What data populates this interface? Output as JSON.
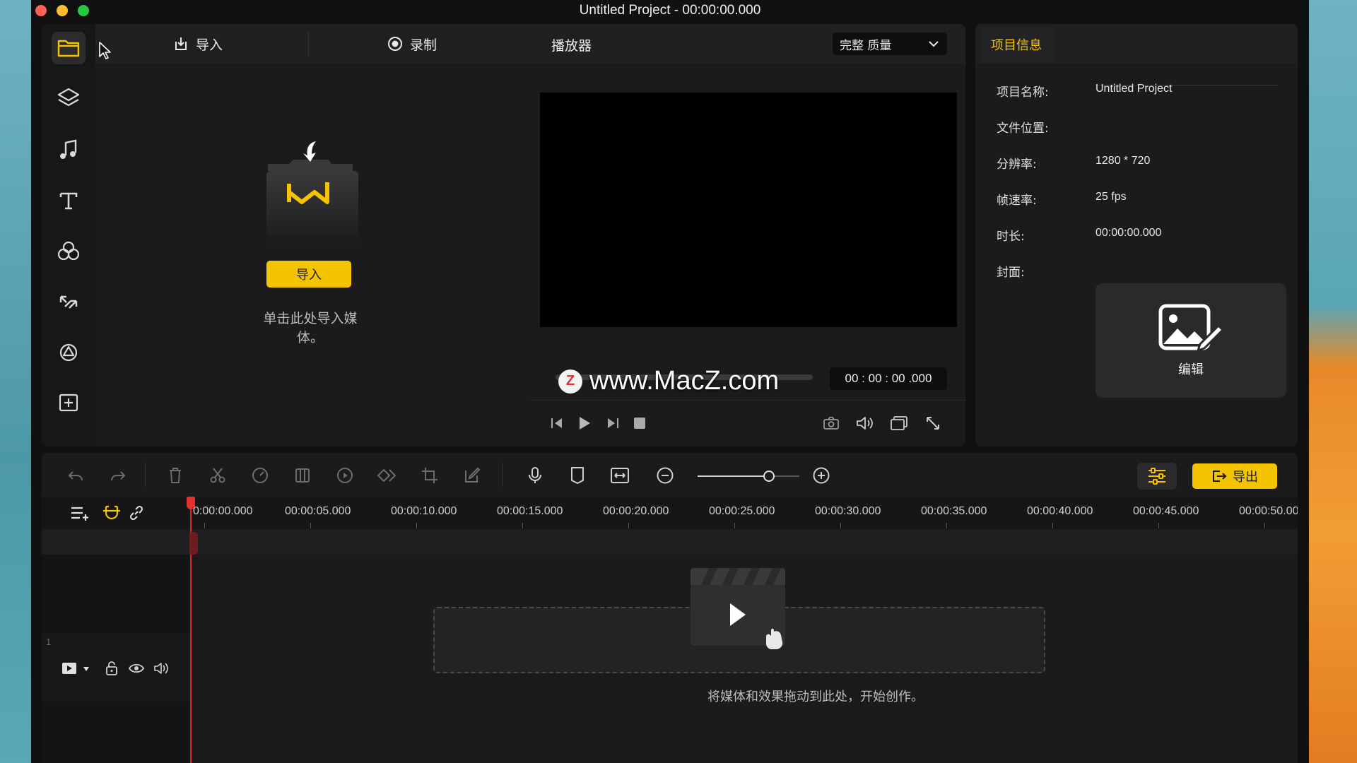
{
  "window": {
    "title": "Untitled Project - 00:00:00.000",
    "accent": "#f5c400",
    "traffic_lights": [
      "#fe5f57",
      "#febc2e",
      "#28c840"
    ]
  },
  "media": {
    "tabs": {
      "import": "导入",
      "record": "录制"
    },
    "import_button": "导入",
    "hint": "单击此处导入媒体。"
  },
  "player": {
    "title": "播放器",
    "quality": "完整 质量",
    "timecode": "00 : 00 : 00 .000",
    "watermark": "www.MacZ.com"
  },
  "info": {
    "tab": "项目信息",
    "rows": [
      {
        "label": "项目名称:",
        "value": "Untitled Project"
      },
      {
        "label": "文件位置:",
        "value": ""
      },
      {
        "label": "分辨率:",
        "value": "1280 * 720"
      },
      {
        "label": "帧速率:",
        "value": "25 fps"
      },
      {
        "label": "时长:",
        "value": "00:00:00.000"
      },
      {
        "label": "封面:",
        "value": ""
      }
    ],
    "cover_edit": "编辑"
  },
  "timeline": {
    "export_label": "导出",
    "ruler": [
      "0:00:00.000",
      "00:00:05.000",
      "00:00:10.000",
      "00:00:15.000",
      "00:00:20.000",
      "00:00:25.000",
      "00:00:30.000",
      "00:00:35.000",
      "00:00:40.000",
      "00:00:45.000",
      "00:00:50.00"
    ],
    "track_number": "1",
    "drop_hint": "将媒体和效果拖动到此处，开始创作。"
  }
}
